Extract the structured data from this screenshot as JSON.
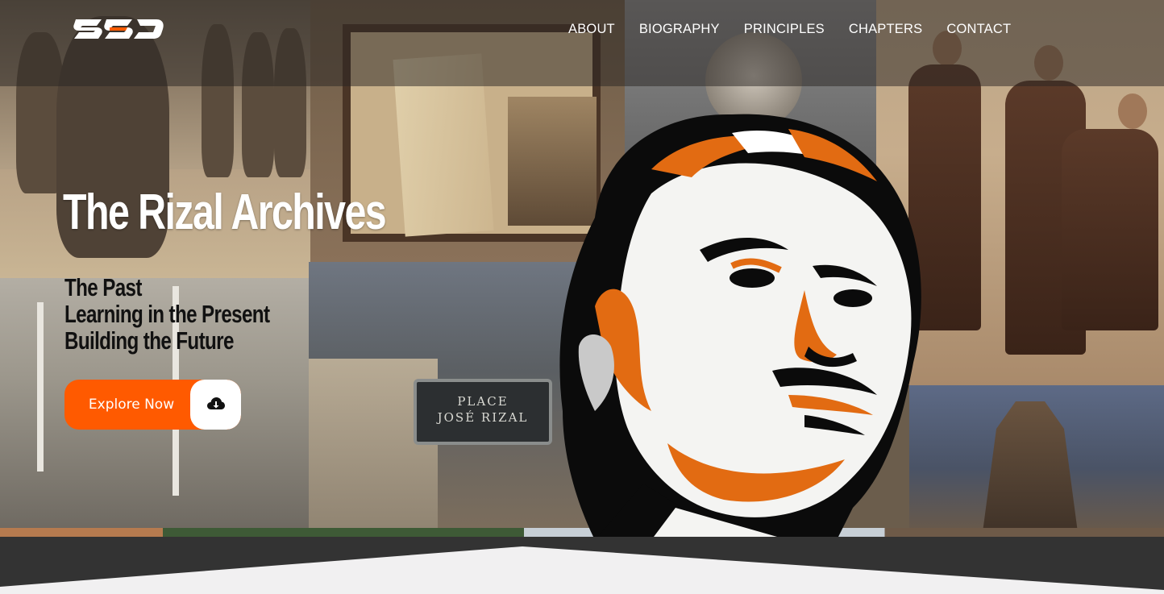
{
  "brand": {
    "logo_text": "SSD",
    "accent": "#ff5a00"
  },
  "nav": {
    "items": [
      {
        "label": "ABOUT"
      },
      {
        "label": "BIOGRAPHY"
      },
      {
        "label": "PRINCIPLES"
      },
      {
        "label": "CHAPTERS"
      },
      {
        "label": "CONTACT"
      }
    ]
  },
  "hero": {
    "title": "The Rizal Archives",
    "tagline": [
      "The Past",
      "Learning in the Present",
      "Building the Future"
    ],
    "cta_label": "Explore Now",
    "cta_icon": "cloud-download-icon",
    "sign_line1": "PLACE",
    "sign_line2": "JOSÉ RIZAL"
  },
  "colors": {
    "cta_bg": "#ff5a00",
    "bottom_dark": "#333333",
    "bottom_light": "#f1f0f1"
  }
}
